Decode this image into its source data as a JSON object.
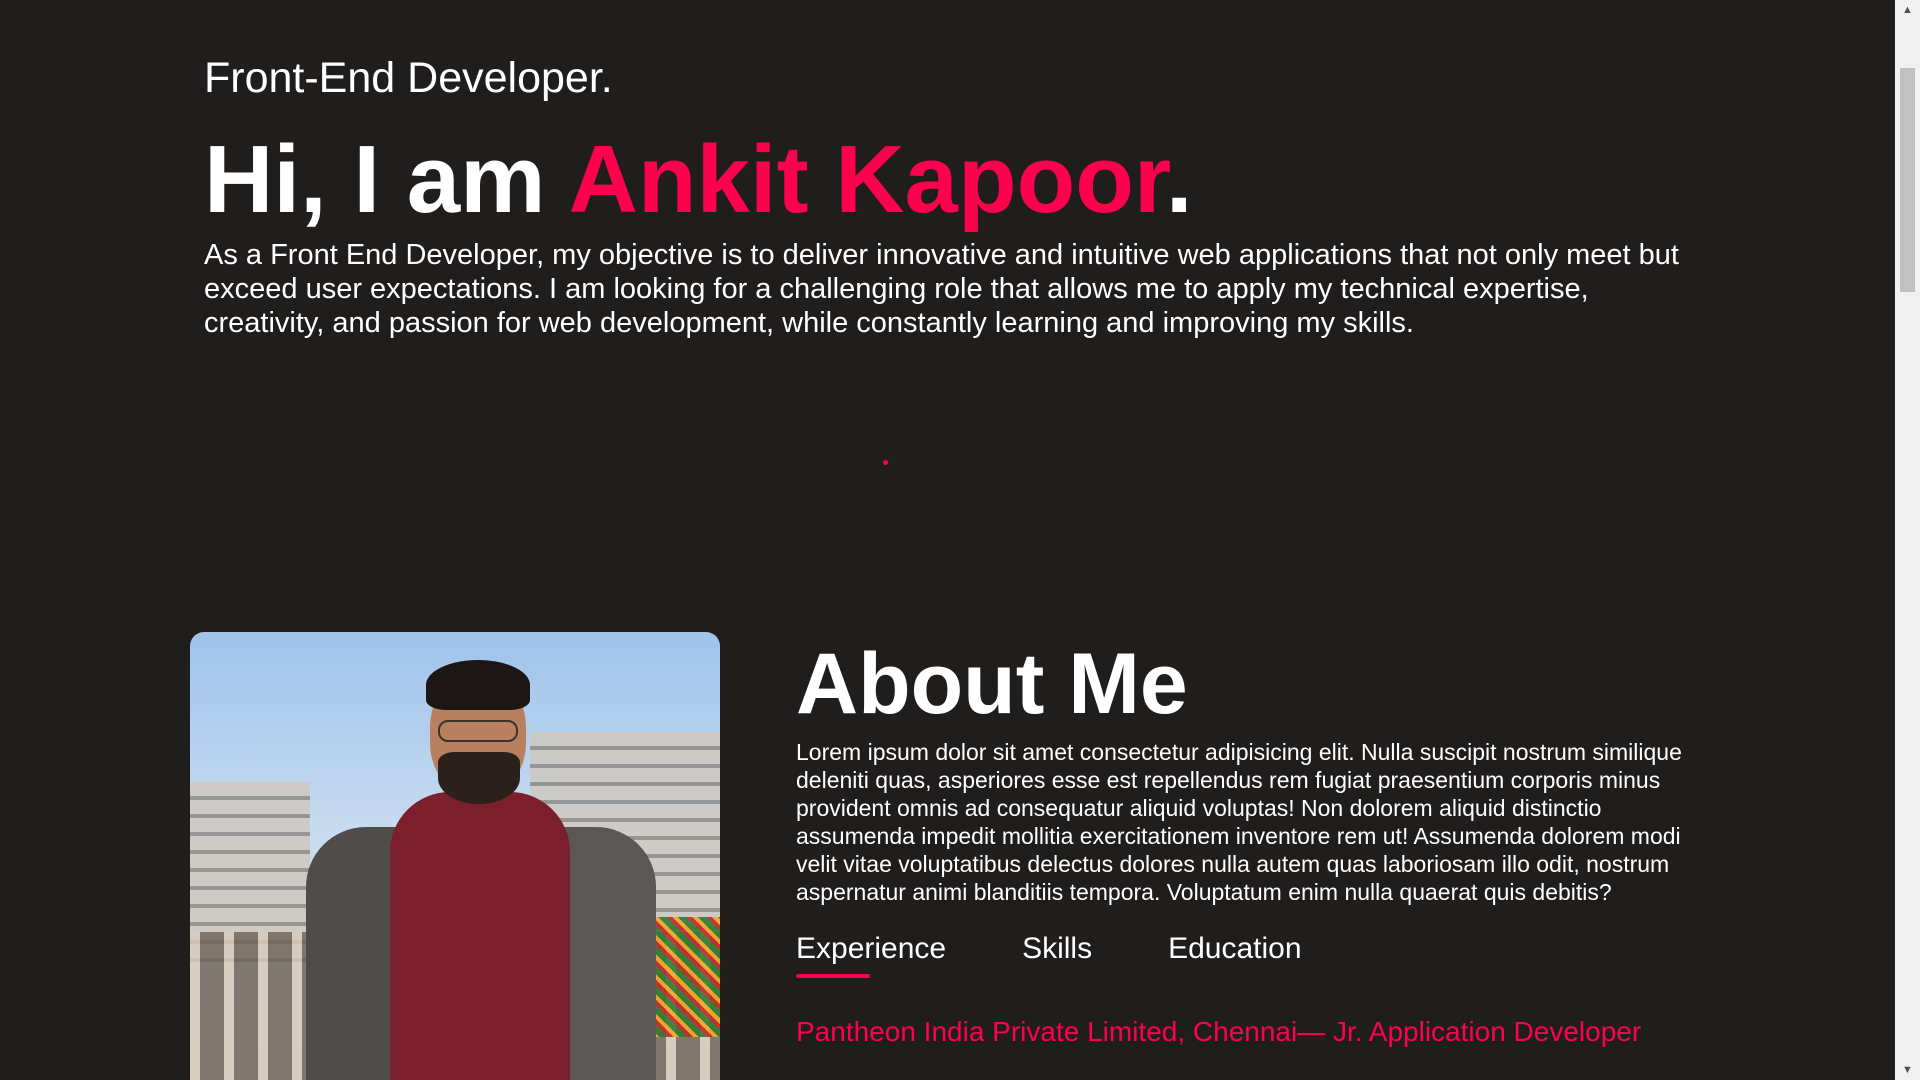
{
  "hero": {
    "role": "Front-End Developer.",
    "greeting": "Hi, I am ",
    "name": "Ankit Kapoor",
    "period": ".",
    "objective": "As a Front End Developer, my objective is to deliver innovative and intuitive web applications that not only meet but exceed user expectations. I am looking for a challenging role that allows me to apply my technical expertise, creativity, and passion for web development, while constantly learning and improving my skills."
  },
  "about": {
    "title": "About Me",
    "text": "Lorem ipsum dolor sit amet consectetur adipisicing elit. Nulla suscipit nostrum similique deleniti quas, asperiores esse est repellendus rem fugiat praesentium corporis minus provident omnis ad consequatur aliquid voluptas! Non dolorem aliquid distinctio assumenda impedit mollitia exercitationem inventore rem ut! Assumenda dolorem modi velit vitae voluptatibus delectus dolores nulla autem quas laboriosam illo odit, nostrum aspernatur animi blanditiis tempora. Voluptatum enim nulla quaerat quis debitis?",
    "tabs": [
      {
        "label": "Experience",
        "active": true
      },
      {
        "label": "Skills",
        "active": false
      },
      {
        "label": "Education",
        "active": false
      }
    ],
    "experience_entry": "Pantheon India Private Limited, Chennai— Jr. Application Developer"
  },
  "colors": {
    "background": "#201d1d",
    "accent": "#ff004f",
    "text": "#ffffff"
  },
  "icons": {
    "scroll_up": "scroll-up-arrow-icon",
    "scroll_down": "scroll-down-arrow-icon"
  }
}
